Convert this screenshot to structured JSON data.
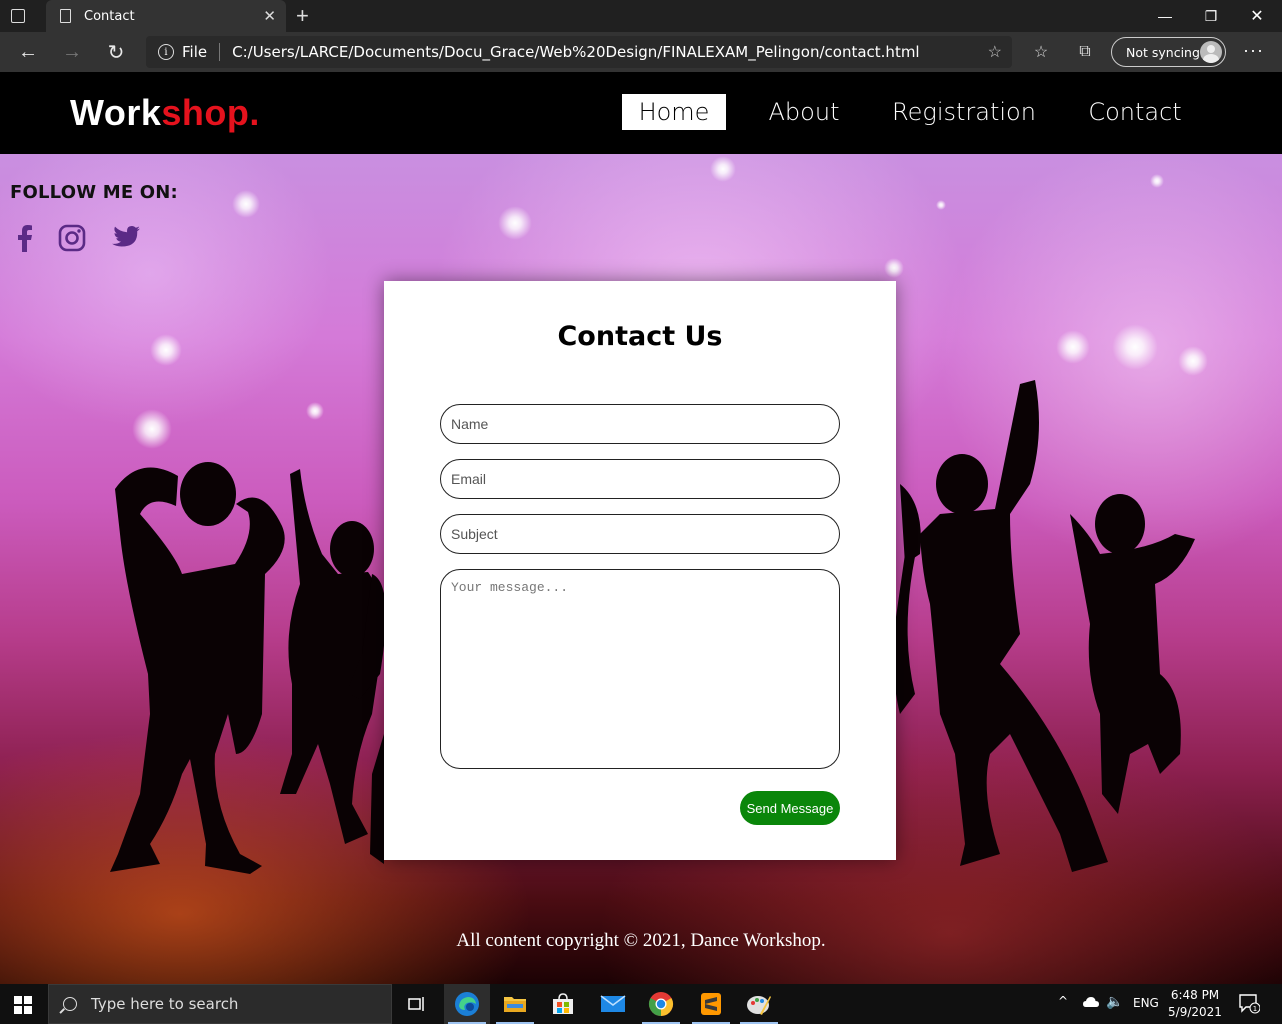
{
  "browser": {
    "tab_title": "Contact",
    "address_scheme": "File",
    "address_url": "C:/Users/LARCE/Documents/Docu_Grace/Web%20Design/FINALEXAM_Pelingon/contact.html",
    "sync_label": "Not syncing"
  },
  "site": {
    "logo_part1": "Work",
    "logo_part2": "shop.",
    "nav": [
      {
        "label": "Home",
        "active": true
      },
      {
        "label": "About",
        "active": false
      },
      {
        "label": "Registration",
        "active": false
      },
      {
        "label": "Contact",
        "active": false
      }
    ],
    "follow_label": "FOLLOW ME ON:",
    "social_icons": [
      "facebook-icon",
      "instagram-icon",
      "twitter-icon"
    ],
    "social_color": "#5b2a86"
  },
  "contact_form": {
    "heading": "Contact Us",
    "name_placeholder": "Name",
    "email_placeholder": "Email",
    "subject_placeholder": "Subject",
    "message_placeholder": "Your message...",
    "send_label": "Send Message",
    "send_color": "#0a860a"
  },
  "footer": {
    "copyright": "All content copyright © 2021, Dance Workshop."
  },
  "taskbar": {
    "search_placeholder": "Type here to search",
    "language": "ENG",
    "time": "6:48 PM",
    "date": "5/9/2021",
    "notification_count": "1"
  }
}
